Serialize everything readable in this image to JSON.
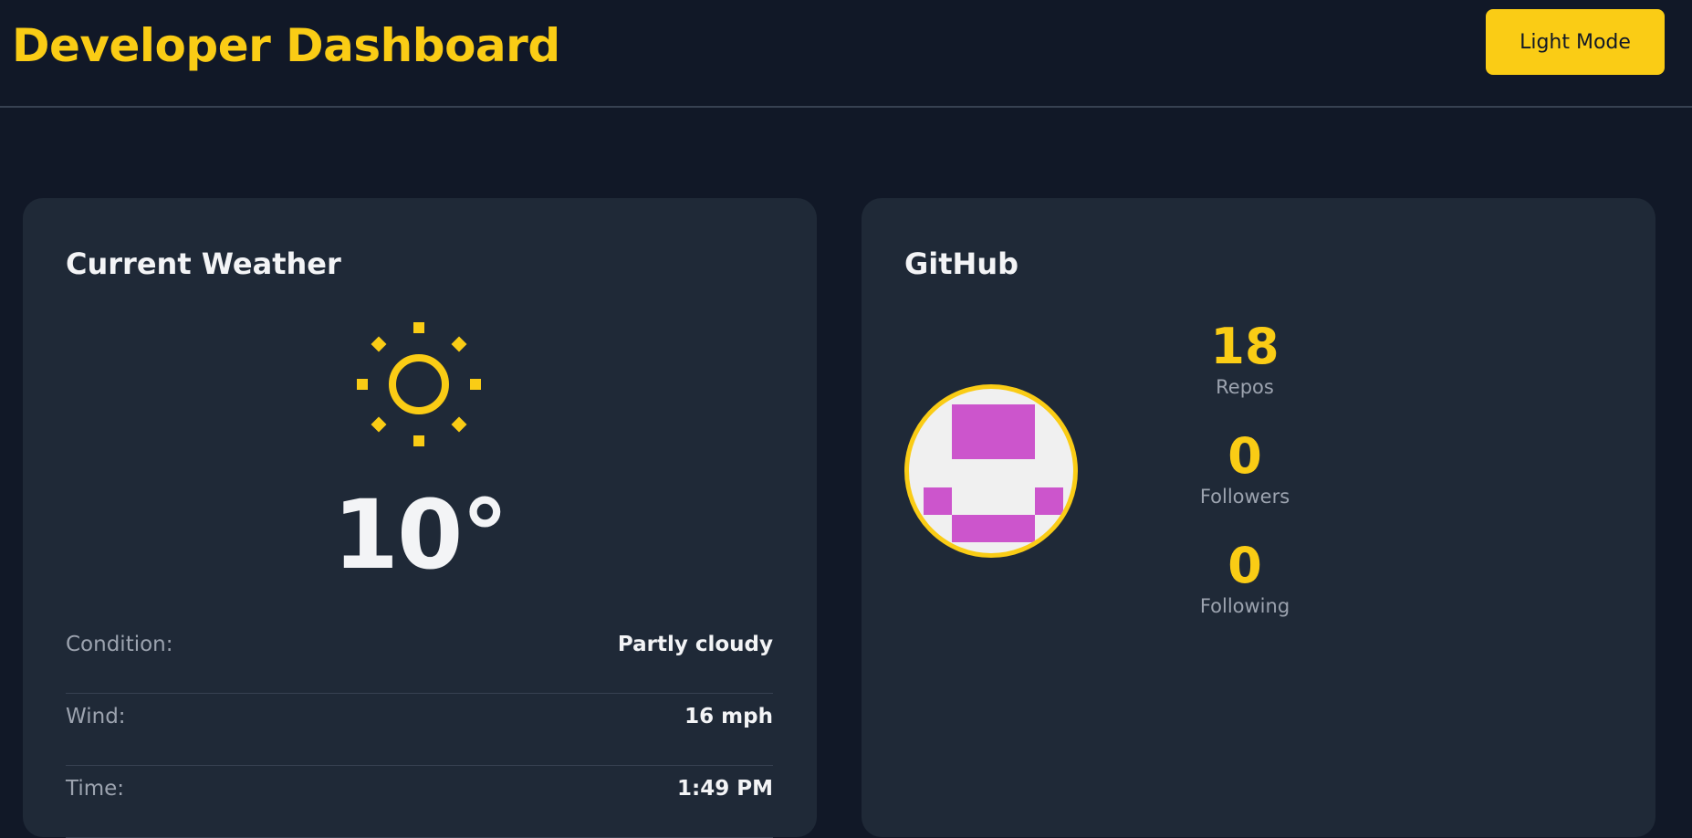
{
  "header": {
    "title": "Developer Dashboard",
    "mode_button_label": "Light Mode"
  },
  "weather": {
    "title": "Current Weather",
    "icon": "sun-icon",
    "temperature": "10°",
    "details": [
      {
        "label": "Condition:",
        "value": "Partly cloudy"
      },
      {
        "label": "Wind:",
        "value": "16 mph"
      },
      {
        "label": "Time:",
        "value": "1:49 PM"
      }
    ]
  },
  "github": {
    "title": "GitHub",
    "avatar_icon": "identicon-avatar",
    "stats": [
      {
        "value": "18",
        "label": "Repos"
      },
      {
        "value": "0",
        "label": "Followers"
      },
      {
        "value": "0",
        "label": "Following"
      }
    ]
  },
  "colors": {
    "background": "#111827",
    "card": "#1f2937",
    "accent": "#facc15",
    "text": "#f3f4f6",
    "muted": "#9ca3af",
    "identicon": "#cc55cc"
  }
}
